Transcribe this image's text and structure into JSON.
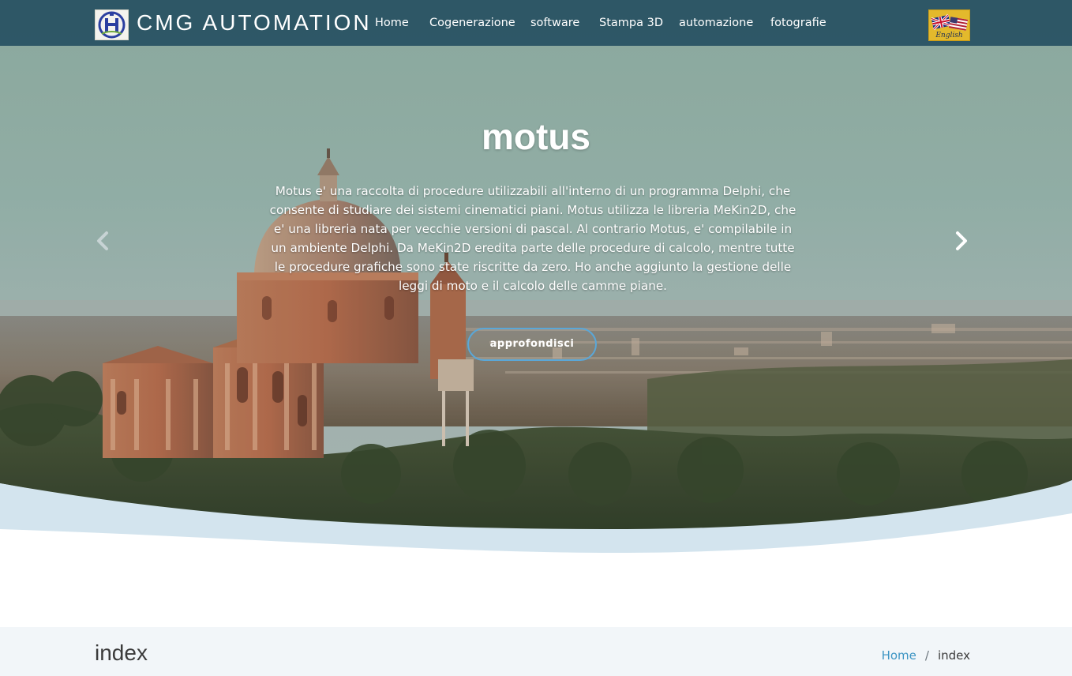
{
  "header": {
    "brand": "CMG AUTOMATION",
    "language_label": "English",
    "bg_color": "#265062",
    "nav": [
      {
        "id": "home",
        "label": "Home"
      },
      {
        "id": "cogenerazione",
        "label": "Cogenerazione"
      },
      {
        "id": "software",
        "label": "software"
      },
      {
        "id": "stampa3d",
        "label": "Stampa 3D"
      },
      {
        "id": "automazione",
        "label": "automazione"
      },
      {
        "id": "fotografie",
        "label": "fotografie"
      }
    ]
  },
  "hero": {
    "title": "motus",
    "text": "Motus e' una raccolta di procedure utilizzabili all'interno di un programma Delphi, che consente di studiare dei sistemi cinematici piani. Motus utilizza le libreria MeKin2D, che e' una libreria nata per vecchie versioni di pascal. Al contrario Motus, e' compilabile in un ambiente Delphi. Da MeKin2D eredita parte delle procedure di calcolo, mentre tutte le procedure grafiche sono state riscritte da zero. Ho anche aggiunto la gestione delle leggi di moto e il calcolo delle camme piane.",
    "cta_label": "approfondisci",
    "accent_color": "#5aa7d8",
    "wave_color": "#d3e4ee"
  },
  "page": {
    "title": "index",
    "breadcrumb_home": "Home",
    "breadcrumb_sep": "/",
    "breadcrumb_current": "index"
  },
  "icons": {
    "logo": "cmg-logo-icon",
    "flag": "uk-us-flag-icon",
    "prev": "chevron-left-icon",
    "next": "chevron-right-icon"
  }
}
